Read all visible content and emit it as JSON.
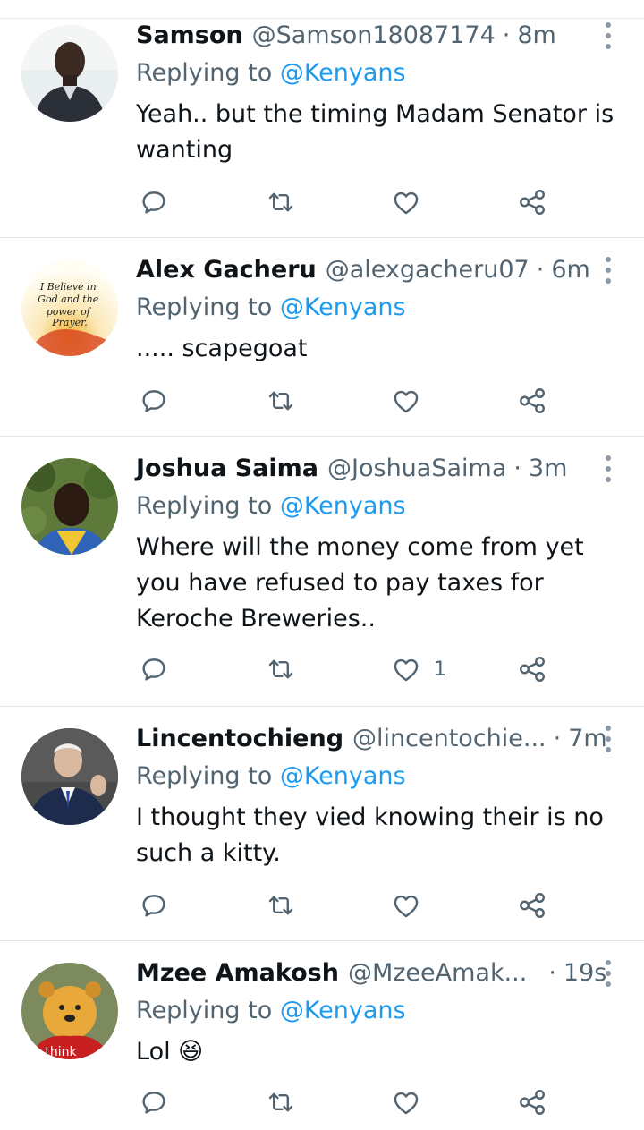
{
  "colors": {
    "accent": "#1d9bf0",
    "secondary_text": "#536471",
    "divider": "#e1e8ed"
  },
  "icons": {
    "reply": "reply-icon",
    "retweet": "retweet-icon",
    "like": "heart-icon",
    "share": "share-icon",
    "more": "more-vertical-icon"
  },
  "tweets": [
    {
      "name": "Samson",
      "handle": "@Samson18087174",
      "separator": "·",
      "time": "8m",
      "replying_label": "Replying to",
      "replying_to": "@Kenyans",
      "text": "Yeah.. but the timing Madam Senator is wanting",
      "like_count": ""
    },
    {
      "name": "Alex Gacheru",
      "handle": "@alexgacheru07",
      "separator": "·",
      "time": "6m",
      "replying_label": "Replying to",
      "replying_to": "@Kenyans",
      "text": "..... scapegoat",
      "like_count": "",
      "avatar_text": "I Believe in God and the power of Prayer."
    },
    {
      "name": "Joshua Saima",
      "handle": "@JoshuaSaima",
      "separator": "·",
      "time": "3m",
      "replying_label": "Replying to",
      "replying_to": "@Kenyans",
      "text": "Where will the money come from yet you have refused to pay taxes for Keroche Breweries..",
      "like_count": "1"
    },
    {
      "name": "Lincentochieng",
      "handle": "@lincentochie...",
      "separator": "·",
      "time": "7m",
      "replying_label": "Replying to",
      "replying_to": "@Kenyans",
      "text": "I thought they vied knowing their is no such a kitty.",
      "like_count": ""
    },
    {
      "name": "Mzee Amakosh",
      "handle": "@MzeeAmak...",
      "separator": "·",
      "time": "19s",
      "replying_label": "Replying to",
      "replying_to": "@Kenyans",
      "text": "Lol 😆",
      "like_count": "",
      "avatar_text": "think"
    }
  ]
}
